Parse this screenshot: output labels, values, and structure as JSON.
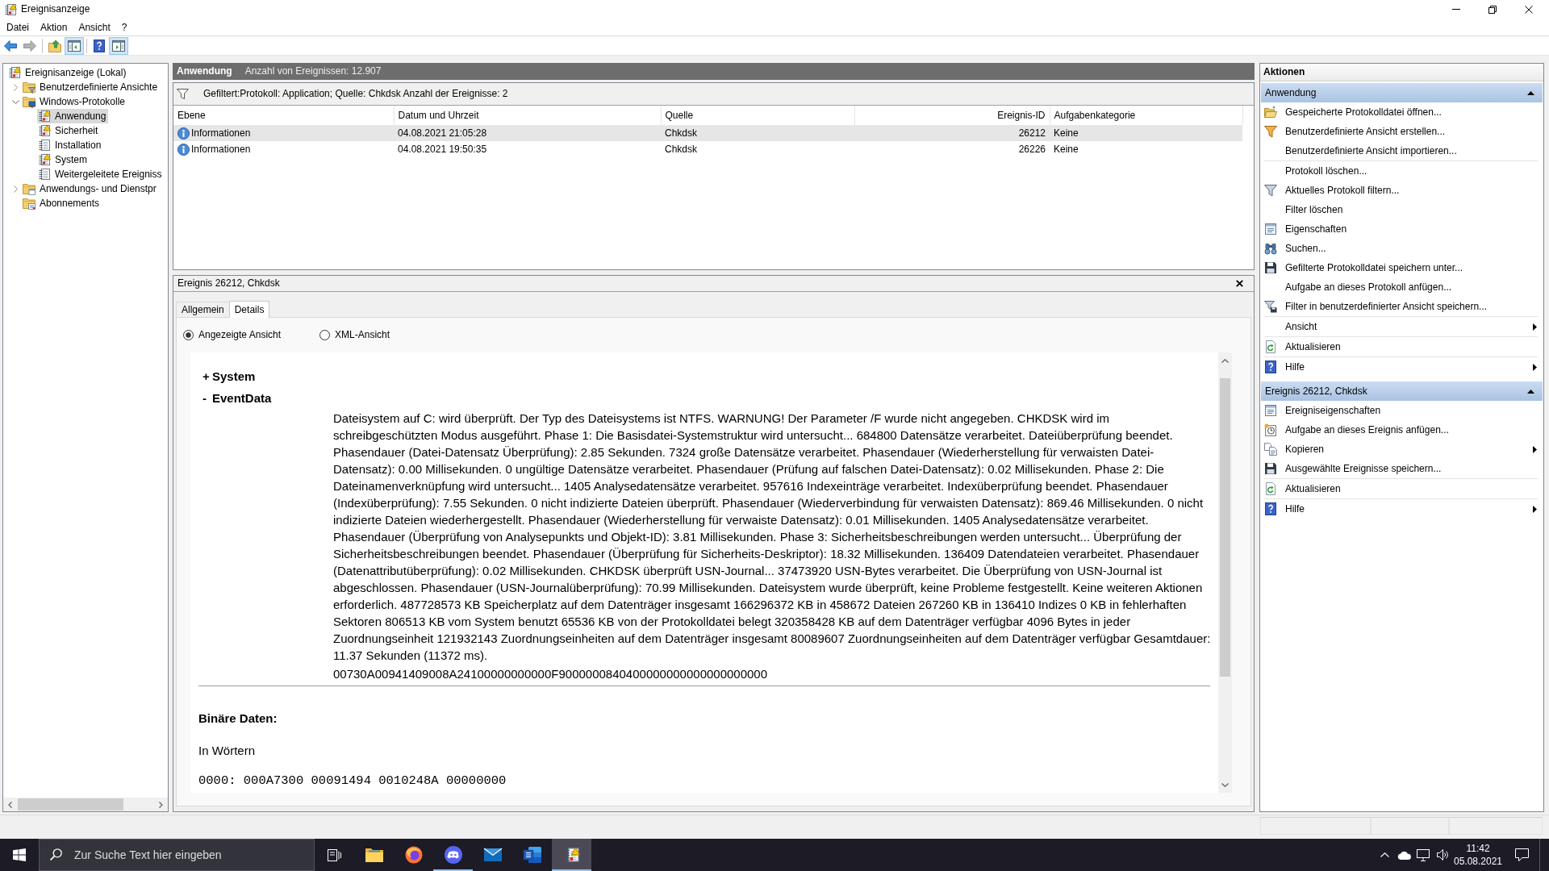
{
  "window": {
    "title": "Ereignisanzeige"
  },
  "menu": [
    "Datei",
    "Aktion",
    "Ansicht",
    "?"
  ],
  "toolbar": [
    [
      {
        "disabled": false,
        "pressed": false
      },
      {
        "disabled": true,
        "pressed": false
      }
    ],
    [
      {
        "disabled": false,
        "pressed": false
      },
      {
        "disabled": false,
        "pressed": true
      }
    ],
    [
      {
        "disabled": false,
        "pressed": false
      },
      {
        "disabled": false,
        "pressed": true
      }
    ]
  ],
  "tree": [
    {
      "label": "Ereignisanzeige (Lokal)",
      "selected": false,
      "children": [
        {
          "label": "Benutzerdefinierte Ansichte",
          "selected": false,
          "expanded": false
        },
        {
          "label": "Windows-Protokolle",
          "selected": false,
          "expanded": true,
          "children": [
            {
              "label": "Anwendung",
              "selected": true
            },
            {
              "label": "Sicherheit",
              "selected": false
            },
            {
              "label": "Installation",
              "selected": false
            },
            {
              "label": "System",
              "selected": false
            },
            {
              "label": "Weitergeleitete Ereigniss",
              "selected": false
            }
          ]
        },
        {
          "label": "Anwendungs- und Dienstpr",
          "selected": false,
          "expanded": false
        },
        {
          "label": "Abonnements",
          "selected": false
        }
      ]
    }
  ],
  "log_header": {
    "title": "Anwendung",
    "count": "Anzahl von Ereignissen: 12.907"
  },
  "filter": "Gefiltert:Protokoll: Application; Quelle: Chkdsk Anzahl der Ereignisse: 2",
  "table": {
    "columns": [
      "Ebene",
      "Datum und Uhrzeit",
      "Quelle",
      "Ereignis-ID",
      "Aufgabenkategorie"
    ],
    "rows": [
      {
        "cells": [
          "Informationen",
          "04.08.2021 21:05:28",
          "Chkdsk",
          "26212",
          "Keine"
        ],
        "selected": true
      },
      {
        "cells": [
          "Informationen",
          "04.08.2021 19:50:35",
          "Chkdsk",
          "26226",
          "Keine"
        ],
        "selected": false
      }
    ]
  },
  "event": {
    "title": "Ereignis 26212, Chkdsk",
    "tabs": [
      {
        "label": "Allgemein",
        "selected": false
      },
      {
        "label": "Details",
        "selected": true
      }
    ],
    "views": [
      {
        "label": "Angezeigte Ansicht",
        "selected": true
      },
      {
        "label": "XML-Ansicht",
        "selected": false
      }
    ],
    "sections": [
      {
        "toggle": "+",
        "title": "System"
      },
      {
        "toggle": "-",
        "title": "EventData",
        "data": [
          "Dateisystem auf C: wird überprüft. Der Typ des Dateisystems ist NTFS. WARNUNG! Der Parameter /F wurde nicht angegeben. CHKDSK wird im schreibgeschützten Modus ausgeführt. Phase 1: Die Basisdatei-Systemstruktur wird untersucht... 684800 Datensätze verarbeitet. Dateiüberprüfung beendet. Phasendauer (Datei-Datensatz Überprüfung): 2.85 Sekunden. 7324 große Datensätze verarbeitet. Phasendauer (Wiederherstellung für verwaisten Datei-Datensatz): 0.00 Millisekunden. 0 ungültige Datensätze verarbeitet. Phasendauer (Prüfung auf falschen Datei-Datensatz): 0.02 Millisekunden. Phase 2: Die Dateinamenverknüpfung wird untersucht... 1405 Analysedatensätze verarbeitet. 957616 Indexeinträge verarbeitet. Indexüberprüfung beendet. Phasendauer (Indexüberprüfung): 7.55 Sekunden. 0 nicht indizierte Dateien überprüft. Phasendauer (Wiederverbindung für verwaisten Datensatz): 869.46 Millisekunden. 0 nicht indizierte Dateien wiederhergestellt. Phasendauer (Wiederherstellung für verwaiste Datensatz): 0.01 Millisekunden. 1405 Analysedatensätze verarbeitet. Phasendauer (Überprüfung von Analysepunkts und Objekt-ID): 3.81 Millisekunden. Phase 3: Sicherheitsbeschreibungen werden untersucht... Überprüfung der Sicherheitsbeschreibungen beendet. Phasendauer (Überprüfung für Sicherheits-Deskriptor): 18.32 Millisekunden. 136409 Datendateien verarbeitet. Phasendauer (Datenattributüberprüfung): 0.02 Millisekunden. CHKDSK überprüft USN-Journal... 37473920 USN-Bytes verarbeitet. Die Überprüfung von USN-Journal ist abgeschlossen. Phasendauer (USN-Journalüberprüfung): 70.99 Millisekunden. Dateisystem wurde überprüft, keine Probleme festgestellt. Keine weiteren Aktionen erforderlich. 487728573 KB Speicherplatz auf dem Datenträger insgesamt 166296372 KB in 458672 Dateien 267260 KB in 136410 Indizes 0 KB in fehlerhaften Sektoren 806513 KB vom System benutzt 65536 KB von der Protokolldatei belegt 320358428 KB auf dem Datenträger verfügbar 4096 Bytes in jeder Zuordnungseinheit 121932143 Zuordnungseinheiten auf dem Datenträger insgesamt 80089607 Zuordnungseinheiten auf dem Datenträger verfügbar Gesamtdauer: 11.37 Sekunden (11372 ms).",
          "00730A00941409008A24100000000000F9000000840400000000000000000000"
        ]
      }
    ],
    "binary": {
      "title": "Binäre Daten:",
      "format": "In Wörtern",
      "lines": [
        "0000: 000A7300 00091494 0010248A 00000000"
      ]
    }
  },
  "actions": {
    "title": "Aktionen",
    "sections": [
      {
        "title": "Anwendung",
        "expanded": true,
        "groups": [
          [
            {
              "label": "Gespeicherte Protokolldatei öffnen...",
              "submenu": false
            },
            {
              "label": "Benutzerdefinierte Ansicht erstellen...",
              "submenu": false
            },
            {
              "label": "Benutzerdefinierte Ansicht importieren...",
              "submenu": false
            }
          ],
          [
            {
              "label": "Protokoll löschen...",
              "submenu": false
            },
            {
              "label": "Aktuelles Protokoll filtern...",
              "submenu": false
            },
            {
              "label": "Filter löschen",
              "submenu": false
            },
            {
              "label": "Eigenschaften",
              "submenu": false
            },
            {
              "label": "Suchen...",
              "submenu": false
            },
            {
              "label": "Gefilterte Protokolldatei speichern unter...",
              "submenu": false
            },
            {
              "label": "Aufgabe an dieses Protokoll anfügen...",
              "submenu": false
            },
            {
              "label": "Filter in benutzerdefinierter Ansicht speichern...",
              "submenu": false
            }
          ],
          [
            {
              "label": "Ansicht",
              "submenu": true
            }
          ],
          [
            {
              "label": "Aktualisieren",
              "submenu": false
            }
          ],
          [
            {
              "label": "Hilfe",
              "submenu": true
            }
          ]
        ]
      },
      {
        "title": "Ereignis 26212, Chkdsk",
        "expanded": true,
        "groups": [
          [
            {
              "label": "Ereigniseigenschaften",
              "submenu": false
            },
            {
              "label": "Aufgabe an dieses Ereignis anfügen...",
              "submenu": false
            },
            {
              "label": "Kopieren",
              "submenu": true
            },
            {
              "label": "Ausgewählte Ereignisse speichern...",
              "submenu": false
            }
          ],
          [
            {
              "label": "Aktualisieren",
              "submenu": false
            }
          ],
          [
            {
              "label": "Hilfe",
              "submenu": true
            }
          ]
        ]
      }
    ]
  },
  "taskbar": {
    "search": {
      "placeholder": "Zur Suche Text hier eingeben"
    },
    "apps": [
      {
        "selected": false,
        "running": false
      },
      {
        "selected": false,
        "running": false
      },
      {
        "selected": false,
        "running": true
      },
      {
        "selected": false,
        "running": false
      },
      {
        "selected": false,
        "running": false
      },
      {
        "selected": true,
        "running": true
      }
    ],
    "clock": {
      "time": "11:42",
      "date": "05.08.2021"
    }
  }
}
